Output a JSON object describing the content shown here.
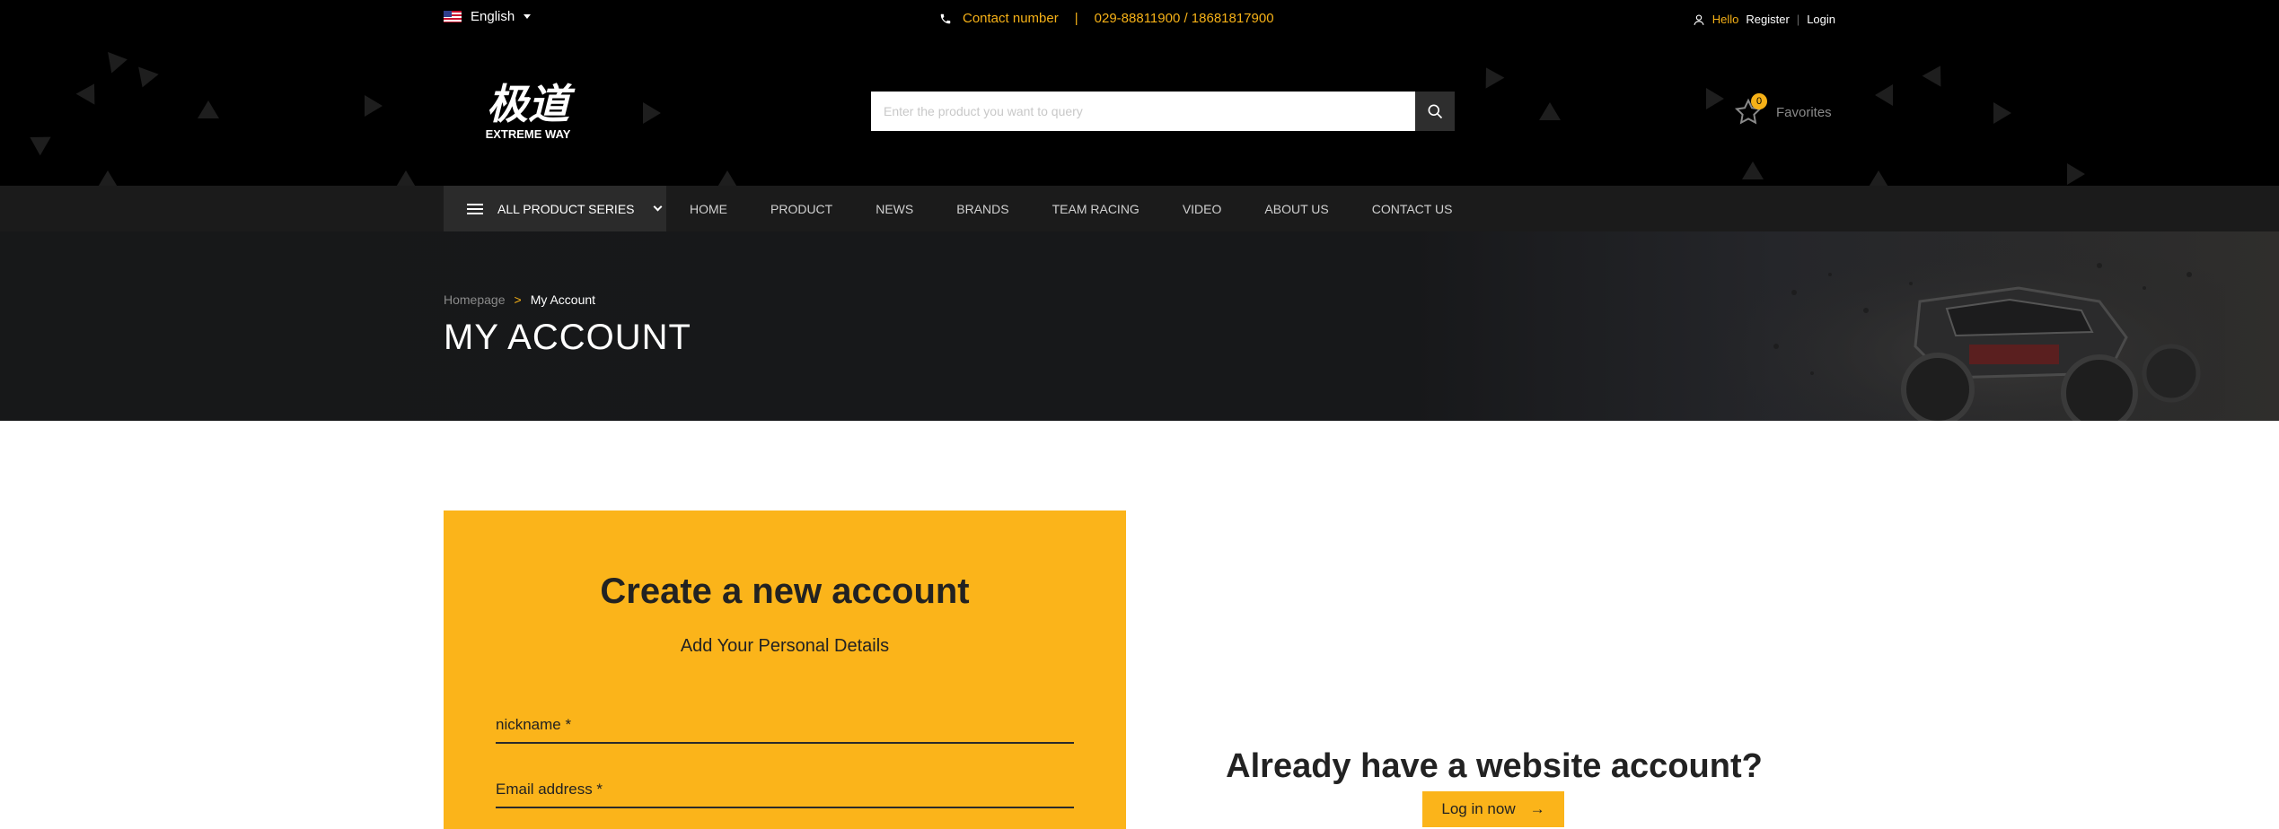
{
  "topbar": {
    "language": "English",
    "contact_label": "Contact number",
    "contact_separator": "|",
    "contact_numbers": "029-88811900 / 18681817900",
    "hello": "Hello",
    "register": "Register",
    "divider": "|",
    "login": "Login"
  },
  "logo": {
    "chinese": "极道",
    "english": "EXTREME WAY"
  },
  "search": {
    "placeholder": "Enter the product you want to query"
  },
  "favorites": {
    "label": "Favorites",
    "count": "0"
  },
  "nav": {
    "all_series": "ALL PRODUCT SERIES",
    "items": [
      "HOME",
      "PRODUCT",
      "NEWS",
      "BRANDS",
      "TEAM RACING",
      "VIDEO",
      "ABOUT US",
      "CONTACT US"
    ]
  },
  "banner": {
    "breadcrumb_home": "Homepage",
    "breadcrumb_sep": ">",
    "breadcrumb_current": "My Account",
    "title": "MY ACCOUNT"
  },
  "register_form": {
    "title": "Create a new account",
    "subtitle": "Add Your Personal Details",
    "nickname_placeholder": "nickname *",
    "email_placeholder": "Email address *"
  },
  "login_prompt": {
    "title": "Already have a website account?",
    "button": "Log in now",
    "button_arrow": "→"
  },
  "colors": {
    "accent": "#fbb41a",
    "header_bg": "#000000",
    "nav_bg": "#1b1b1b"
  }
}
